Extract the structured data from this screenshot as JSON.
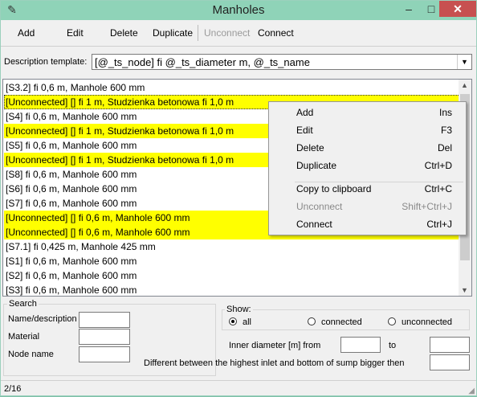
{
  "window": {
    "title": "Manholes",
    "controls": {
      "minimize": "–",
      "maximize": "□",
      "close": "✕"
    }
  },
  "toolbar": {
    "add": "Add",
    "edit": "Edit",
    "delete": "Delete",
    "duplicate": "Duplicate",
    "unconnect": "Unconnect",
    "connect": "Connect"
  },
  "description": {
    "label": "Description template:",
    "value": "[@_ts_node] fi @_ts_diameter m, @_ts_name"
  },
  "list": {
    "rows": [
      {
        "text": "[S3.2] fi 0,6 m, Manhole 600 mm",
        "highlighted": false
      },
      {
        "text": "[Unconnected] [] fi 1 m, Studzienka betonowa fi 1,0 m",
        "highlighted": true
      },
      {
        "text": "[S4] fi 0,6 m, Manhole 600 mm",
        "highlighted": false
      },
      {
        "text": "[Unconnected] [] fi 1 m, Studzienka betonowa fi 1,0 m",
        "highlighted": true
      },
      {
        "text": "[S5] fi 0,6 m, Manhole 600 mm",
        "highlighted": false
      },
      {
        "text": "[Unconnected] [] fi 1 m, Studzienka betonowa fi 1,0 m",
        "highlighted": true
      },
      {
        "text": "[S8] fi 0,6 m, Manhole 600 mm",
        "highlighted": false
      },
      {
        "text": "[S6] fi 0,6 m, Manhole 600 mm",
        "highlighted": false
      },
      {
        "text": "[S7] fi 0,6 m, Manhole 600 mm",
        "highlighted": false
      },
      {
        "text": "[Unconnected] [] fi 0,6 m, Manhole 600 mm",
        "highlighted": true
      },
      {
        "text": "[Unconnected] [] fi 0,6 m, Manhole 600 mm",
        "highlighted": true
      },
      {
        "text": "[S7.1] fi 0,425 m, Manhole 425 mm",
        "highlighted": false
      },
      {
        "text": "[S1] fi 0,6 m, Manhole 600 mm",
        "highlighted": false
      },
      {
        "text": "[S2] fi 0,6 m, Manhole 600 mm",
        "highlighted": false
      },
      {
        "text": "[S3] fi 0,6 m, Manhole 600 mm",
        "highlighted": false
      }
    ],
    "selected_index": 1,
    "highlight_color": "#ffff00"
  },
  "context_menu": {
    "items": [
      {
        "label": "Add",
        "shortcut": "Ins",
        "disabled": false
      },
      {
        "label": "Edit",
        "shortcut": "F3",
        "disabled": false
      },
      {
        "label": "Delete",
        "shortcut": "Del",
        "disabled": false
      },
      {
        "label": "Duplicate",
        "shortcut": "Ctrl+D",
        "disabled": false
      },
      {
        "label": "Copy to clipboard",
        "shortcut": "Ctrl+C",
        "disabled": false
      },
      {
        "label": "Unconnect",
        "shortcut": "Shift+Ctrl+J",
        "disabled": true
      },
      {
        "label": "Connect",
        "shortcut": "Ctrl+J",
        "disabled": false
      }
    ]
  },
  "search": {
    "title": "Search",
    "name_label": "Name/description",
    "material_label": "Material",
    "node_label": "Node name",
    "name_value": "",
    "material_value": "",
    "node_value": ""
  },
  "show": {
    "title": "Show:",
    "options": [
      "all",
      "connected",
      "unconnected"
    ],
    "selected": "all"
  },
  "filters": {
    "diameter_label": "Inner diameter [m] from",
    "to_label": "to",
    "diameter_from": "",
    "diameter_to": "",
    "sump_label": "Different between the highest inlet and bottom of sump bigger then",
    "sump_value": ""
  },
  "status": {
    "text": "2/16"
  },
  "icons": {
    "app": "manhole-tool-icon",
    "scroll_up": "scroll-up-arrow-icon",
    "scroll_down": "scroll-down-arrow-icon",
    "dropdown": "chevron-down-icon",
    "resize": "resize-grip-icon"
  },
  "colors": {
    "titlebar": "#8fd3b8",
    "close_button": "#c75050",
    "highlight": "#ffff00"
  }
}
